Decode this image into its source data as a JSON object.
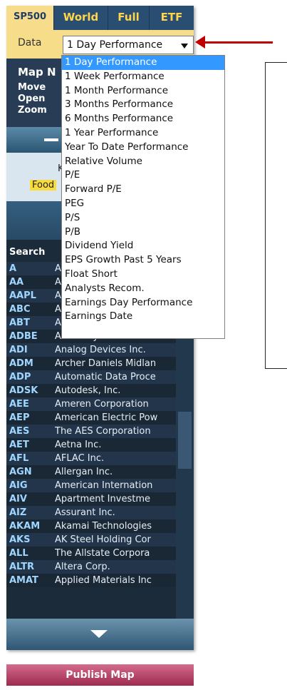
{
  "tabs": [
    {
      "label": "SP500",
      "active": true
    },
    {
      "label": "World",
      "active": false
    },
    {
      "label": "Full",
      "active": false
    },
    {
      "label": "ETF",
      "active": false
    }
  ],
  "data_selector": {
    "label": "Data",
    "value": "1 Day Performance"
  },
  "info": {
    "line1": "Map N",
    "line2": "Move",
    "line3": "Open",
    "line4": "Zoom"
  },
  "legend": {
    "k": "K",
    "food": "Food"
  },
  "search": {
    "label": "Search"
  },
  "dropdown_options": [
    "1 Day Performance",
    "1 Week Performance",
    "1 Month Performance",
    "3 Months Performance",
    "6 Months Performance",
    "1 Year Performance",
    "Year To Date Performance",
    "Relative Volume",
    "P/E",
    "Forward P/E",
    "PEG",
    "P/S",
    "P/B",
    "Dividend Yield",
    "EPS Growth Past 5 Years",
    "Float Short",
    "Analysts Recom.",
    "Earnings Day Performance",
    "Earnings Date"
  ],
  "stocks": [
    {
      "ticker": "A",
      "name": "A"
    },
    {
      "ticker": "AA",
      "name": "A"
    },
    {
      "ticker": "AAPL",
      "name": "A"
    },
    {
      "ticker": "ABC",
      "name": "A"
    },
    {
      "ticker": "ABT",
      "name": "A"
    },
    {
      "ticker": "ADBE",
      "name": "Adobe Systems Inc."
    },
    {
      "ticker": "ADI",
      "name": "Analog Devices Inc."
    },
    {
      "ticker": "ADM",
      "name": "Archer Daniels Midlan"
    },
    {
      "ticker": "ADP",
      "name": "Automatic Data Proce"
    },
    {
      "ticker": "ADSK",
      "name": "Autodesk, Inc."
    },
    {
      "ticker": "AEE",
      "name": "Ameren Corporation"
    },
    {
      "ticker": "AEP",
      "name": "American Electric Pow"
    },
    {
      "ticker": "AES",
      "name": "The AES Corporation"
    },
    {
      "ticker": "AET",
      "name": "Aetna Inc."
    },
    {
      "ticker": "AFL",
      "name": "AFLAC Inc."
    },
    {
      "ticker": "AGN",
      "name": "Allergan Inc."
    },
    {
      "ticker": "AIG",
      "name": "American Internation"
    },
    {
      "ticker": "AIV",
      "name": "Apartment Investme"
    },
    {
      "ticker": "AIZ",
      "name": "Assurant Inc."
    },
    {
      "ticker": "AKAM",
      "name": "Akamai Technologies"
    },
    {
      "ticker": "AKS",
      "name": "AK Steel Holding Cor"
    },
    {
      "ticker": "ALL",
      "name": "The Allstate Corpora"
    },
    {
      "ticker": "ALTR",
      "name": "Altera Corp."
    },
    {
      "ticker": "AMAT",
      "name": "Applied Materials Inc"
    }
  ],
  "publish": {
    "label": "Publish Map"
  },
  "colors": {
    "annotation_arrow": "#c00000",
    "selected_option": "#3398ff",
    "tab_text": "#ffd54a"
  }
}
